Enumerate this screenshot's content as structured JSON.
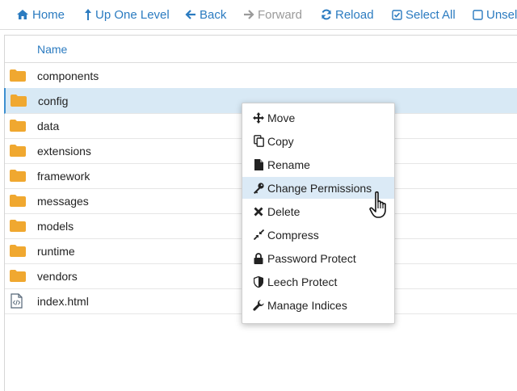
{
  "toolbar": {
    "home": "Home",
    "up": "Up One Level",
    "back": "Back",
    "forward": "Forward",
    "reload": "Reload",
    "select_all": "Select All",
    "unselect": "Unsel"
  },
  "table": {
    "column_name": "Name",
    "rows": [
      {
        "name": "components",
        "type": "folder"
      },
      {
        "name": "config",
        "type": "folder",
        "selected": true
      },
      {
        "name": "data",
        "type": "folder"
      },
      {
        "name": "extensions",
        "type": "folder"
      },
      {
        "name": "framework",
        "type": "folder"
      },
      {
        "name": "messages",
        "type": "folder"
      },
      {
        "name": "models",
        "type": "folder"
      },
      {
        "name": "runtime",
        "type": "folder"
      },
      {
        "name": "vendors",
        "type": "folder"
      },
      {
        "name": "index.html",
        "type": "html-file"
      }
    ]
  },
  "context_menu": {
    "items": [
      {
        "label": "Move",
        "icon": "move-icon"
      },
      {
        "label": "Copy",
        "icon": "copy-icon"
      },
      {
        "label": "Rename",
        "icon": "file-icon"
      },
      {
        "label": "Change Permissions",
        "icon": "key-icon",
        "hovered": true
      },
      {
        "label": "Delete",
        "icon": "times-icon"
      },
      {
        "label": "Compress",
        "icon": "compress-icon"
      },
      {
        "label": "Password Protect",
        "icon": "lock-icon"
      },
      {
        "label": "Leech Protect",
        "icon": "shield-icon"
      },
      {
        "label": "Manage Indices",
        "icon": "wrench-icon"
      }
    ]
  },
  "colors": {
    "link": "#2b7bc0",
    "folder": "#f0a830",
    "selected_row": "#d8e9f5",
    "hover_item": "#dbeaf6",
    "disabled": "#9a9a9a"
  }
}
